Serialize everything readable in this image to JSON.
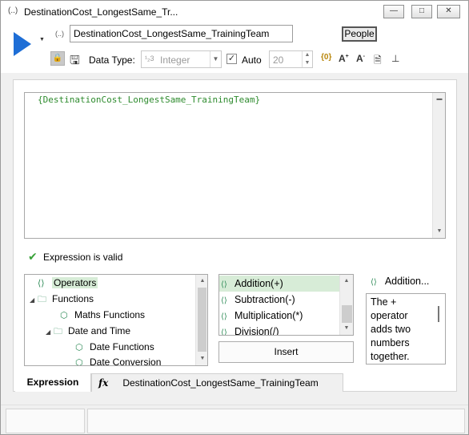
{
  "window": {
    "icon": "(..)",
    "title": "DestinationCost_LongestSame_Tr...",
    "minimize": "—",
    "maximize": "□",
    "close": "✕"
  },
  "toolbar": {
    "var_icon": "(..)",
    "name_value": "DestinationCost_LongestSame_TrainingTeam",
    "people_label": "People",
    "data_type_label": "Data Type:",
    "data_type_glyph": "¹₂3",
    "data_type_value": "Integer",
    "auto_checked": "✓",
    "auto_label": "Auto",
    "size_value": "20",
    "icons": [
      "variable-braces-icon",
      "font-increase-icon",
      "font-decrease-icon",
      "document-icon",
      "hierarchy-icon"
    ]
  },
  "editor": {
    "text": "{DestinationCost_LongestSame_TrainingTeam}"
  },
  "validation": {
    "text": "Expression is valid"
  },
  "tree": {
    "items": [
      {
        "label": "Operators",
        "expander": "",
        "icon": "⟨⟩"
      },
      {
        "label": "Functions",
        "expander": "◢",
        "icon": "🗀"
      },
      {
        "label": "Maths Functions",
        "expander": "",
        "icon": "⬡"
      },
      {
        "label": "Date and Time",
        "expander": "◢",
        "icon": "🗀"
      },
      {
        "label": "Date Functions",
        "expander": "",
        "icon": "⬡"
      },
      {
        "label": "Date Conversion",
        "expander": "",
        "icon": "⬡"
      }
    ]
  },
  "operators": {
    "items": [
      {
        "label": "Addition(+)",
        "icon": "⟨⟩"
      },
      {
        "label": "Subtraction(-)",
        "icon": "⟨⟩"
      },
      {
        "label": "Multiplication(*)",
        "icon": "⟨⟩"
      },
      {
        "label": "Division(/)",
        "icon": "⟨⟩"
      }
    ],
    "insert_label": "Insert"
  },
  "description": {
    "title": "Addition...",
    "lines": [
      "The +",
      "operator",
      "adds two",
      "numbers",
      "together."
    ]
  },
  "tabs": {
    "expression": "Expression",
    "fx": "fx",
    "name": "DestinationCost_LongestSame_TrainingTeam"
  }
}
